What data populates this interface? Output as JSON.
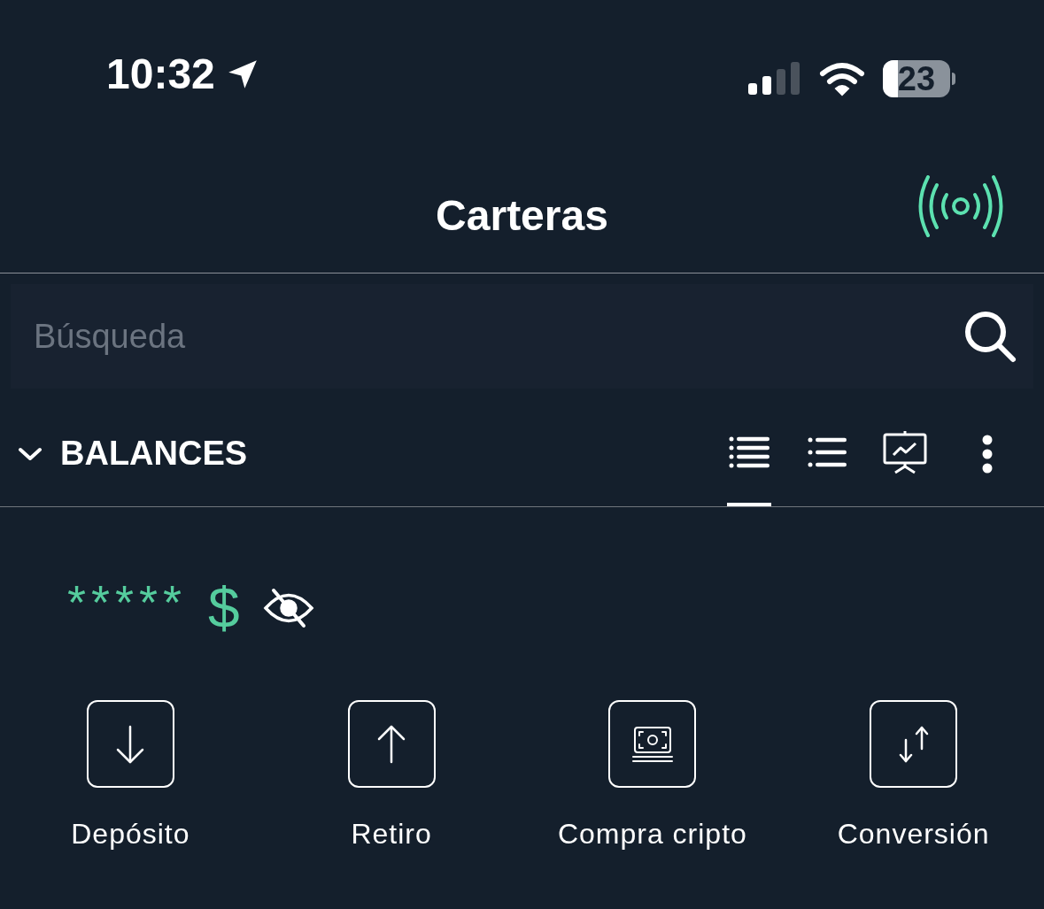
{
  "status_bar": {
    "time": "10:32",
    "battery": "23"
  },
  "header": {
    "title": "Carteras"
  },
  "search": {
    "placeholder": "Búsqueda"
  },
  "section": {
    "title": "BALANCES",
    "expanded": true,
    "view_tabs": [
      {
        "kind": "detailed",
        "selected": true
      },
      {
        "kind": "compact",
        "selected": false
      },
      {
        "kind": "chart",
        "selected": false
      }
    ]
  },
  "balance": {
    "amount": "*****",
    "currency": "$",
    "hidden": true
  },
  "actions": [
    {
      "kind": "deposit",
      "label": "Depósito"
    },
    {
      "kind": "withdraw",
      "label": "Retiro"
    },
    {
      "kind": "buy",
      "label": "Compra cripto"
    },
    {
      "kind": "convert",
      "label": "Conversión"
    }
  ]
}
